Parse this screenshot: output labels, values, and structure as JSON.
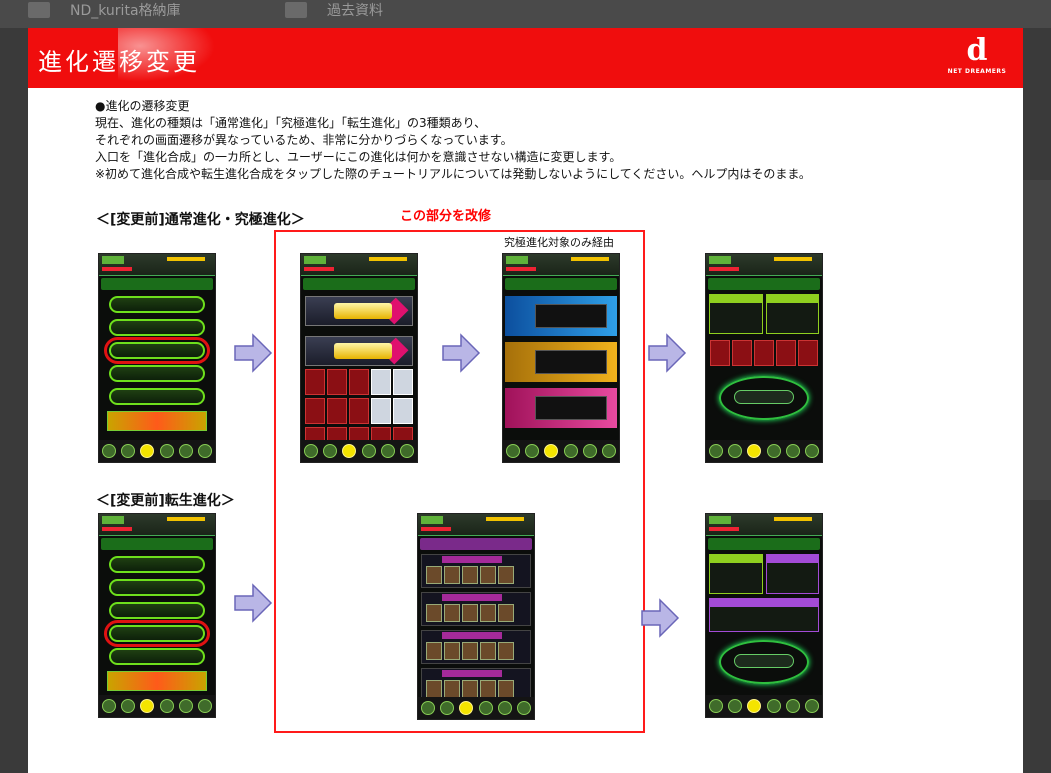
{
  "background": {
    "folders": [
      "ND_kurita格納庫",
      "過去資料"
    ]
  },
  "slide": {
    "title": "進化遷移変更",
    "logo": {
      "mark": "d",
      "brand": "NET DREAMERS"
    },
    "body_lines": [
      "●進化の遷移変更",
      "現在、進化の種類は「通常進化」「究極進化」「転生進化」の3種類あり、",
      "それぞれの画面遷移が異なっているため、非常に分かりづらくなっています。",
      "入口を「進化合成」の一カ所とし、ユーザーにこの進化は何かを意識させない構造に変更します。",
      "※初めて進化合成や転生進化合成をタップした際のチュートリアルについては発動しないようにしてください。ヘルプ内はそのまま。"
    ],
    "section1_heading": "＜[変更前]通常進化・究極進化＞",
    "section2_heading": "＜[変更前]転生進化＞",
    "red_note": "この部分を改修",
    "box_caption": "究極進化対象のみ経由",
    "colors": {
      "header_red": "#f00d0d",
      "highlight_red": "#ff1a1a",
      "arrow_fill": "#b9b6e6"
    }
  }
}
